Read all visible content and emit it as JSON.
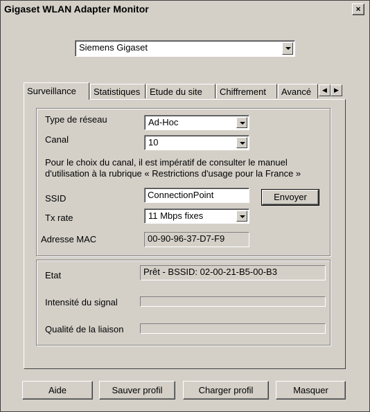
{
  "window": {
    "title": "Gigaset WLAN Adapter Monitor",
    "close_glyph": "×"
  },
  "adapter": {
    "selected": "Siemens Gigaset"
  },
  "tabs": [
    {
      "label": "Surveillance"
    },
    {
      "label": "Statistiques"
    },
    {
      "label": "Etude du site"
    },
    {
      "label": "Chiffrement"
    },
    {
      "label": "Avancé"
    }
  ],
  "surveillance": {
    "network_type": {
      "label": "Type de réseau",
      "value": "Ad-Hoc"
    },
    "channel": {
      "label": "Canal",
      "value": "10"
    },
    "note_line1": "Pour le choix du canal, il est impératif de consulter le manuel",
    "note_line2": "d'utilisation à la rubrique  « Restrictions d'usage pour la France »",
    "ssid": {
      "label": "SSID",
      "value": "ConnectionPoint"
    },
    "send_button": "Envoyer",
    "tx_rate": {
      "label": "Tx rate",
      "value": "11 Mbps fixes"
    },
    "mac": {
      "label": "Adresse MAC",
      "value": "00-90-96-37-D7-F9"
    }
  },
  "status": {
    "state": {
      "label": "Etat",
      "value": "Prêt - BSSID: 02-00-21-B5-00-B3"
    },
    "signal": {
      "label": "Intensité du signal"
    },
    "link_quality": {
      "label": "Qualité de la liaison"
    }
  },
  "footer": {
    "help": "Aide",
    "save_profile": "Sauver profil",
    "load_profile": "Charger profil",
    "hide": "Masquer"
  },
  "icons": {
    "scroll_left": "left-arrow-icon",
    "scroll_right": "right-arrow-icon",
    "dropdown": "chevron-down-icon"
  }
}
